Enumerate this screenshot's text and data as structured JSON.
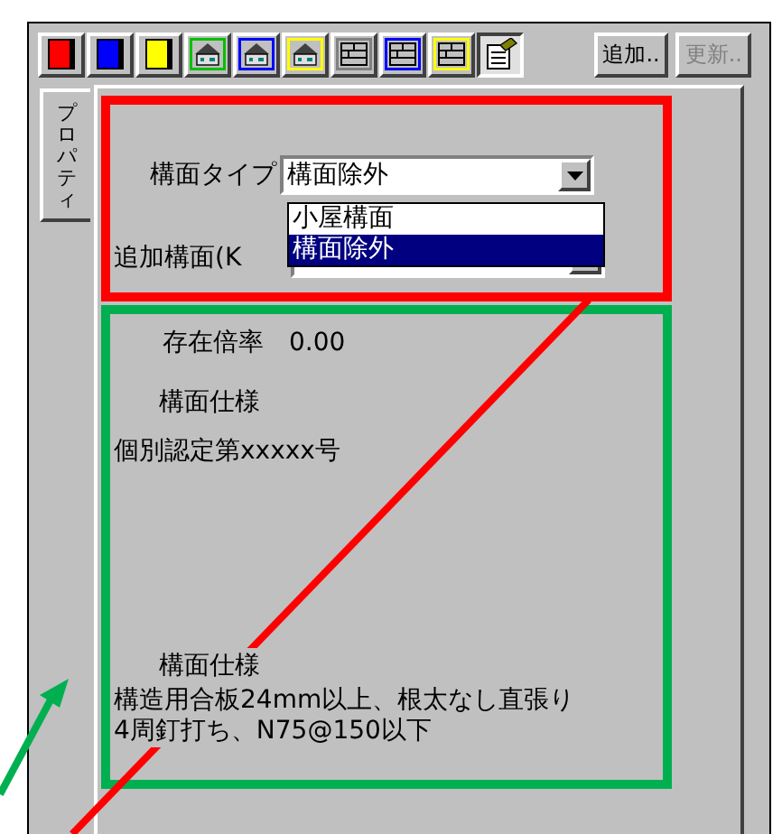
{
  "toolbar": {
    "tools": [
      {
        "kind": "book",
        "color": "#ff0000",
        "selected": false
      },
      {
        "kind": "book",
        "color": "#0000ff",
        "selected": false
      },
      {
        "kind": "book",
        "color": "#ffff00",
        "selected": false
      },
      {
        "kind": "house",
        "color": "#00c000",
        "selected": false
      },
      {
        "kind": "house",
        "color": "#0000ff",
        "selected": false
      },
      {
        "kind": "house",
        "color": "#ffff00",
        "selected": false
      },
      {
        "kind": "panel",
        "color": "#808080",
        "selected": false
      },
      {
        "kind": "panel",
        "color": "#0000ff",
        "selected": false
      },
      {
        "kind": "panel",
        "color": "#ffff00",
        "selected": false
      },
      {
        "kind": "property",
        "selected": true
      }
    ],
    "buttons": [
      {
        "label": "追加..",
        "disabled": false
      },
      {
        "label": "更新..",
        "disabled": true
      }
    ]
  },
  "side_tab": {
    "label": "プロパティ",
    "selected": true
  },
  "form": {
    "type_label": "構面タイプ",
    "type_value": "構面除外",
    "type_options": [
      {
        "label": "小屋構面",
        "selected": false
      },
      {
        "label": "構面除外",
        "selected": true
      }
    ],
    "extra_label": "追加構面(K"
  },
  "info": {
    "rate_label": "存在倍率",
    "rate_value": "0.00",
    "spec_label": "構面仕様",
    "spec_value": "個別認定第xxxxx号",
    "spec2_label": "構面仕様",
    "spec2_value": "構造用合板24mm以上、根太なし直張り4周釘打ち、N75@150以下"
  }
}
